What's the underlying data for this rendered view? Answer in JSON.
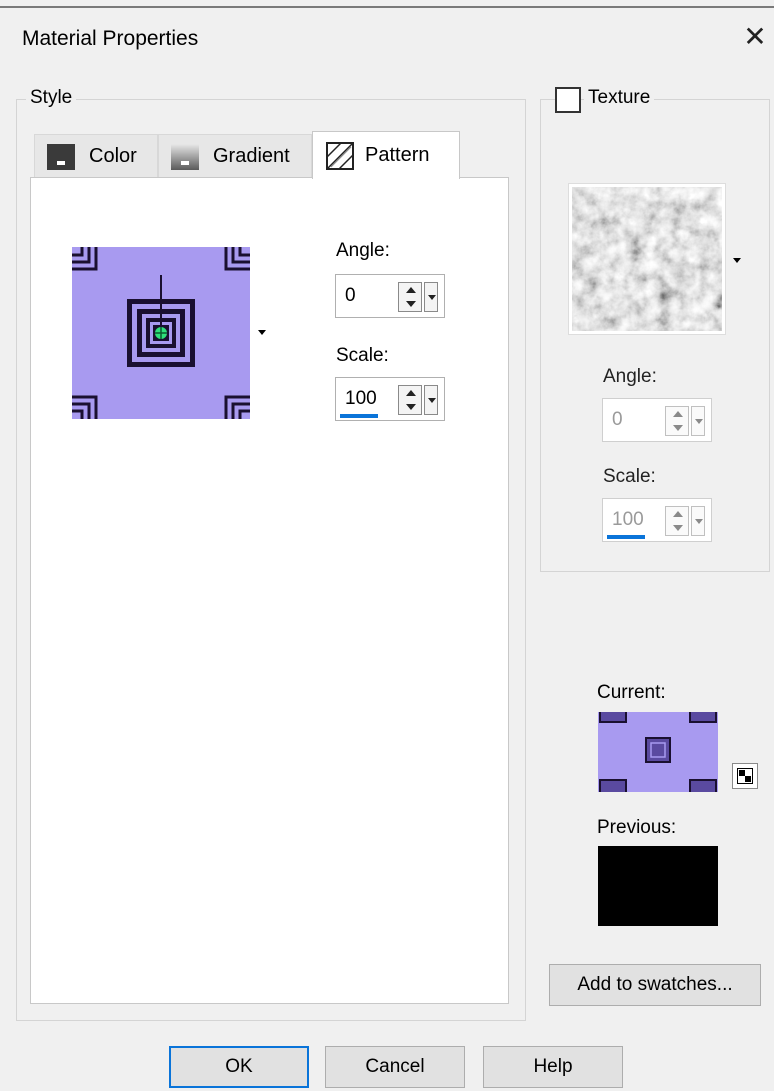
{
  "window": {
    "title": "Material Properties",
    "close_glyph": "✕"
  },
  "style_group": {
    "label": "Style",
    "tabs": [
      {
        "label": "Color",
        "icon": "color-swatch-icon"
      },
      {
        "label": "Gradient",
        "icon": "gradient-swatch-icon"
      },
      {
        "label": "Pattern",
        "icon": "pattern-hatch-icon",
        "selected": true
      }
    ],
    "pattern": {
      "swatch_color": "#a89af0",
      "angle_label": "Angle:",
      "angle_value": "0",
      "scale_label": "Scale:",
      "scale_value": "100"
    }
  },
  "texture_group": {
    "label": "Texture",
    "checked": false,
    "angle_label": "Angle:",
    "angle_value": "0",
    "scale_label": "Scale:",
    "scale_value": "100"
  },
  "preview": {
    "current_label": "Current:",
    "previous_label": "Previous:",
    "previous_color": "#000000"
  },
  "buttons": {
    "add_to_swatches": "Add to swatches...",
    "ok": "OK",
    "cancel": "Cancel",
    "help": "Help"
  },
  "colors": {
    "accent": "#0a74d9",
    "pattern_lavender": "#a89af0",
    "pattern_dark": "#1a1030"
  }
}
